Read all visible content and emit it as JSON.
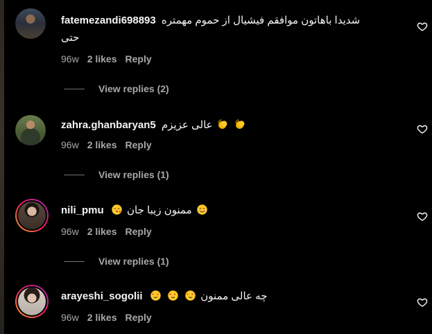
{
  "comments": [
    {
      "username": "fatemezandi698893",
      "text": "شدیدا باهاتون موافقم فیشیال از حموم مهمتره حتی",
      "time": "96w",
      "likes": "2 likes",
      "reply": "Reply",
      "view_replies": "View replies (2)"
    },
    {
      "username": "zahra.ghanbaryan5",
      "text": "عالی عزیزم",
      "time": "96w",
      "likes": "2 likes",
      "reply": "Reply",
      "view_replies": "View replies (1)"
    },
    {
      "username": "nili_pmu",
      "text": "ممنون زیبا جان",
      "time": "96w",
      "likes": "2 likes",
      "reply": "Reply",
      "view_replies": "View replies (1)"
    },
    {
      "username": "arayeshi_sogolii",
      "text": "چه عالی ممنون",
      "time": "96w",
      "likes": "2 likes",
      "reply": "Reply"
    }
  ],
  "icons": {
    "like": "heart-outline-icon",
    "clap": "clapping-hands-emoji",
    "kiss": "face-blowing-kiss-emoji",
    "smile": "smiling-face-emoji",
    "heart_eyes": "heart-eyes-emoji"
  },
  "colors": {
    "background": "#000000",
    "text": "#f5f5f5",
    "secondary": "#a8a8a8",
    "story_ring_start": "#f9a825",
    "story_ring_end": "#9c27b0"
  }
}
